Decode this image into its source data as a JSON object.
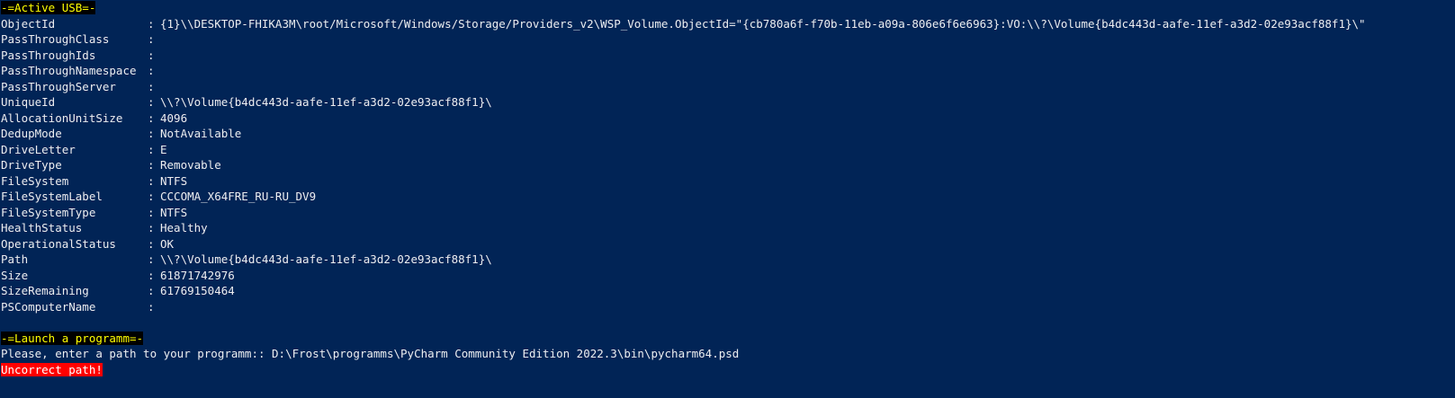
{
  "colors": {
    "background": "#012456",
    "text": "#eeedf0",
    "heading_bg": "#000000",
    "heading_fg": "#ffff00",
    "error_bg": "#ff0000",
    "error_fg": "#ffffff"
  },
  "usb_section": {
    "heading": "-=Active USB=-",
    "separator": ":",
    "properties": [
      {
        "key": "ObjectId",
        "value": "{1}\\\\DESKTOP-FHIKA3M\\root/Microsoft/Windows/Storage/Providers_v2\\WSP_Volume.ObjectId=\"{cb780a6f-f70b-11eb-a09a-806e6f6e6963}:VO:\\\\?\\Volume{b4dc443d-aafe-11ef-a3d2-02e93acf88f1}\\\""
      },
      {
        "key": "PassThroughClass",
        "value": ""
      },
      {
        "key": "PassThroughIds",
        "value": ""
      },
      {
        "key": "PassThroughNamespace",
        "value": ""
      },
      {
        "key": "PassThroughServer",
        "value": ""
      },
      {
        "key": "UniqueId",
        "value": "\\\\?\\Volume{b4dc443d-aafe-11ef-a3d2-02e93acf88f1}\\"
      },
      {
        "key": "AllocationUnitSize",
        "value": "4096"
      },
      {
        "key": "DedupMode",
        "value": "NotAvailable"
      },
      {
        "key": "DriveLetter",
        "value": "E"
      },
      {
        "key": "DriveType",
        "value": "Removable"
      },
      {
        "key": "FileSystem",
        "value": "NTFS"
      },
      {
        "key": "FileSystemLabel",
        "value": "CCCOMA_X64FRE_RU-RU_DV9"
      },
      {
        "key": "FileSystemType",
        "value": "NTFS"
      },
      {
        "key": "HealthStatus",
        "value": "Healthy"
      },
      {
        "key": "OperationalStatus",
        "value": "OK"
      },
      {
        "key": "Path",
        "value": "\\\\?\\Volume{b4dc443d-aafe-11ef-a3d2-02e93acf88f1}\\"
      },
      {
        "key": "Size",
        "value": "61871742976"
      },
      {
        "key": "SizeRemaining",
        "value": "61769150464"
      },
      {
        "key": "PSComputerName",
        "value": ""
      }
    ]
  },
  "launch_section": {
    "heading": "-=Launch a programm=-",
    "prompt": "Please, enter a path to your programm:: D:\\Frost\\programms\\PyCharm Community Edition 2022.3\\bin\\pycharm64.psd",
    "error": "Uncorrect path!"
  }
}
